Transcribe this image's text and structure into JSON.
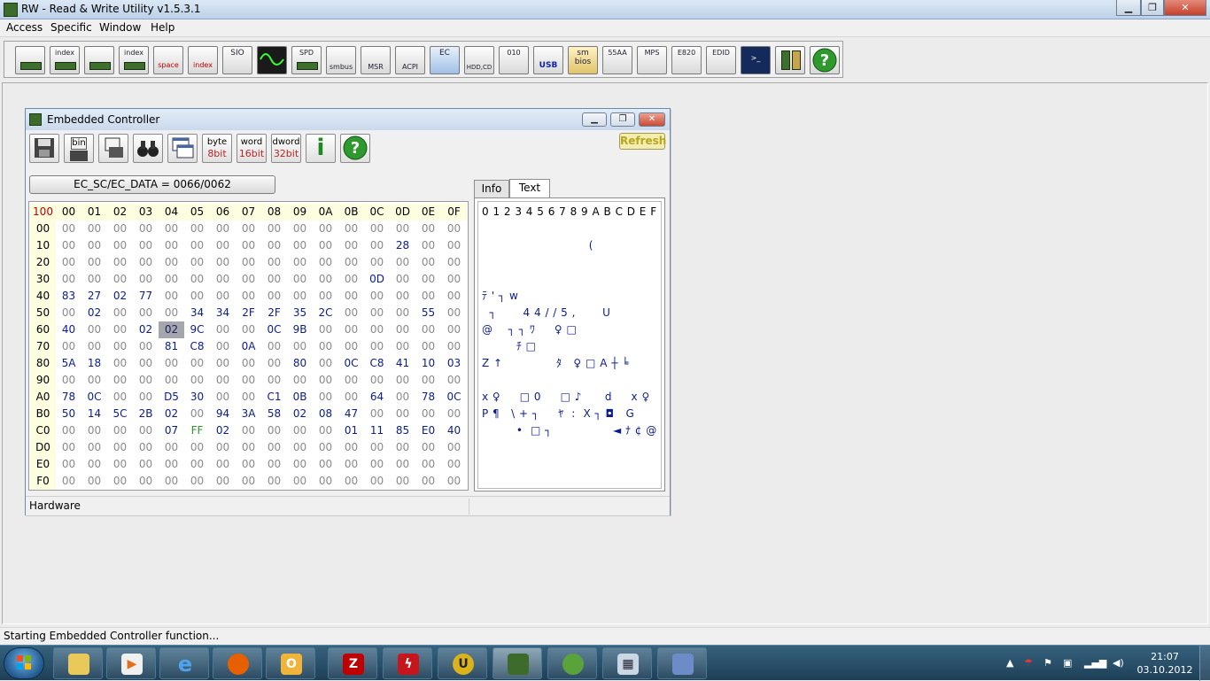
{
  "app": {
    "title": "RW - Read & Write Utility v1.5.3.1",
    "menu": [
      "Access",
      "Specific",
      "Window",
      "Help"
    ]
  },
  "toolbar_labels": [
    "",
    "index",
    "",
    "index",
    "space",
    "index",
    "SIO",
    "",
    "SPD",
    "smbus",
    "MSR",
    "ACPI",
    "EC",
    "HDD,CD",
    "010",
    "USB",
    "sm bios",
    "55AA",
    "MPS",
    "E820",
    "EDID",
    "",
    "",
    ""
  ],
  "ec_window": {
    "title": "Embedded Controller",
    "toolbar": {
      "byte_top": "byte",
      "byte_bottom": "8bit",
      "word_top": "word",
      "word_bottom": "16bit",
      "dword_top": "dword",
      "dword_bottom": "32bit",
      "bin": "bin",
      "info_i": "i",
      "help_q": "?"
    },
    "refresh_label": "Refresh",
    "address_label": "EC_SC/EC_DATA = 0066/0062",
    "corner": "100",
    "columns": [
      "00",
      "01",
      "02",
      "03",
      "04",
      "05",
      "06",
      "07",
      "08",
      "09",
      "0A",
      "0B",
      "0C",
      "0D",
      "0E",
      "0F"
    ],
    "rows": [
      {
        "h": "00",
        "v": [
          "00",
          "00",
          "00",
          "00",
          "00",
          "00",
          "00",
          "00",
          "00",
          "00",
          "00",
          "00",
          "00",
          "00",
          "00",
          "00"
        ]
      },
      {
        "h": "10",
        "v": [
          "00",
          "00",
          "00",
          "00",
          "00",
          "00",
          "00",
          "00",
          "00",
          "00",
          "00",
          "00",
          "00",
          "28",
          "00",
          "00"
        ]
      },
      {
        "h": "20",
        "v": [
          "00",
          "00",
          "00",
          "00",
          "00",
          "00",
          "00",
          "00",
          "00",
          "00",
          "00",
          "00",
          "00",
          "00",
          "00",
          "00"
        ]
      },
      {
        "h": "30",
        "v": [
          "00",
          "00",
          "00",
          "00",
          "00",
          "00",
          "00",
          "00",
          "00",
          "00",
          "00",
          "00",
          "0D",
          "00",
          "00",
          "00"
        ]
      },
      {
        "h": "40",
        "v": [
          "83",
          "27",
          "02",
          "77",
          "00",
          "00",
          "00",
          "00",
          "00",
          "00",
          "00",
          "00",
          "00",
          "00",
          "00",
          "00"
        ]
      },
      {
        "h": "50",
        "v": [
          "00",
          "02",
          "00",
          "00",
          "00",
          "34",
          "34",
          "2F",
          "2F",
          "35",
          "2C",
          "00",
          "00",
          "00",
          "55",
          "00"
        ]
      },
      {
        "h": "60",
        "v": [
          "40",
          "00",
          "00",
          "02",
          "02",
          "9C",
          "00",
          "00",
          "0C",
          "9B",
          "00",
          "00",
          "00",
          "00",
          "00",
          "00"
        ]
      },
      {
        "h": "70",
        "v": [
          "00",
          "00",
          "00",
          "00",
          "81",
          "C8",
          "00",
          "0A",
          "00",
          "00",
          "00",
          "00",
          "00",
          "00",
          "00",
          "00"
        ]
      },
      {
        "h": "80",
        "v": [
          "5A",
          "18",
          "00",
          "00",
          "00",
          "00",
          "00",
          "00",
          "00",
          "80",
          "00",
          "0C",
          "C8",
          "41",
          "10",
          "03"
        ]
      },
      {
        "h": "90",
        "v": [
          "00",
          "00",
          "00",
          "00",
          "00",
          "00",
          "00",
          "00",
          "00",
          "00",
          "00",
          "00",
          "00",
          "00",
          "00",
          "00"
        ]
      },
      {
        "h": "A0",
        "v": [
          "78",
          "0C",
          "00",
          "00",
          "D5",
          "30",
          "00",
          "00",
          "C1",
          "0B",
          "00",
          "00",
          "64",
          "00",
          "78",
          "0C"
        ]
      },
      {
        "h": "B0",
        "v": [
          "50",
          "14",
          "5C",
          "2B",
          "02",
          "00",
          "94",
          "3A",
          "58",
          "02",
          "08",
          "47",
          "00",
          "00",
          "00",
          "00"
        ]
      },
      {
        "h": "C0",
        "v": [
          "00",
          "00",
          "00",
          "00",
          "07",
          "FF",
          "02",
          "00",
          "00",
          "00",
          "00",
          "01",
          "11",
          "85",
          "E0",
          "40"
        ]
      },
      {
        "h": "D0",
        "v": [
          "00",
          "00",
          "00",
          "00",
          "00",
          "00",
          "00",
          "00",
          "00",
          "00",
          "00",
          "00",
          "00",
          "00",
          "00",
          "00"
        ]
      },
      {
        "h": "E0",
        "v": [
          "00",
          "00",
          "00",
          "00",
          "00",
          "00",
          "00",
          "00",
          "00",
          "00",
          "00",
          "00",
          "00",
          "00",
          "00",
          "00"
        ]
      },
      {
        "h": "F0",
        "v": [
          "00",
          "00",
          "00",
          "00",
          "00",
          "00",
          "00",
          "00",
          "00",
          "00",
          "00",
          "00",
          "00",
          "00",
          "00",
          "00"
        ]
      }
    ],
    "selected_cell": {
      "row": "60",
      "col": "04"
    },
    "tabs": [
      "Info",
      "Text"
    ],
    "active_tab": "Text",
    "text_header": "0 1 2 3 4 5 6 7 8 9 A B C D E F",
    "text_lines": [
      "",
      "                            (",
      "",
      "",
      "ﾃ ' ┐ w",
      "  ┐       4 4 / / 5 ,       U",
      "@    ┐ ┐ ﾜ     ♀ □",
      "         ﾁ □",
      "Z ↑              ﾀ   ♀ □ A ┼ ╘",
      "",
      "x ♀     □ 0     □ ♪      d     x ♀",
      "P ¶   \\ + ┐     ﾔ  :  X ┐ ◘   G",
      "         •  □ ┐                ◄ ﾅ ¢ @",
      "",
      "",
      ""
    ],
    "status_left": "Hardware"
  },
  "status_bar": "Starting Embedded Controller function...",
  "taskbar": {
    "clock_time": "21:07",
    "clock_date": "03.10.2012"
  }
}
